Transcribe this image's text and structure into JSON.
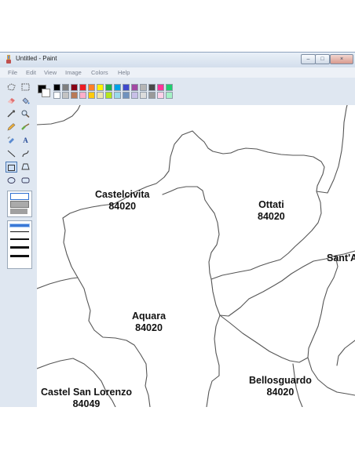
{
  "window": {
    "title": "Untitled - Paint",
    "controls": {
      "minimize": "–",
      "maximize": "□",
      "close": "×"
    }
  },
  "menu": [
    "File",
    "Edit",
    "View",
    "Image",
    "Colors",
    "Help"
  ],
  "tools": {
    "text_tool": "A"
  },
  "palette": {
    "foreground": "#000000",
    "background": "#ffffff",
    "row1": [
      "#000000",
      "#7f7f7f",
      "#880015",
      "#ed1c24",
      "#ff7f27",
      "#fff200",
      "#22b14c",
      "#00a2e8",
      "#3f48cc",
      "#a349a4",
      "#b5b5b5",
      "#4a4a4a",
      "#ff3399",
      "#1fcf6f"
    ],
    "row2": [
      "#ffffff",
      "#c3c3c3",
      "#b97a57",
      "#ffaec9",
      "#ffc90e",
      "#efe4b0",
      "#b5e61d",
      "#99d9ea",
      "#7092be",
      "#c8bfe7",
      "#dcdcdc",
      "#9a9a9a",
      "#ffd1e8",
      "#a5f2c5"
    ]
  },
  "map": {
    "areas": [
      {
        "name": "Castelcivita",
        "cap": "84020"
      },
      {
        "name": "Ottati",
        "cap": "84020"
      },
      {
        "name": "Sant'A",
        "cap": ""
      },
      {
        "name": "Aquara",
        "cap": "84020"
      },
      {
        "name": "Bellosguardo",
        "cap": "84020"
      },
      {
        "name": "Castel San Lorenzo",
        "cap": "84049"
      }
    ]
  }
}
